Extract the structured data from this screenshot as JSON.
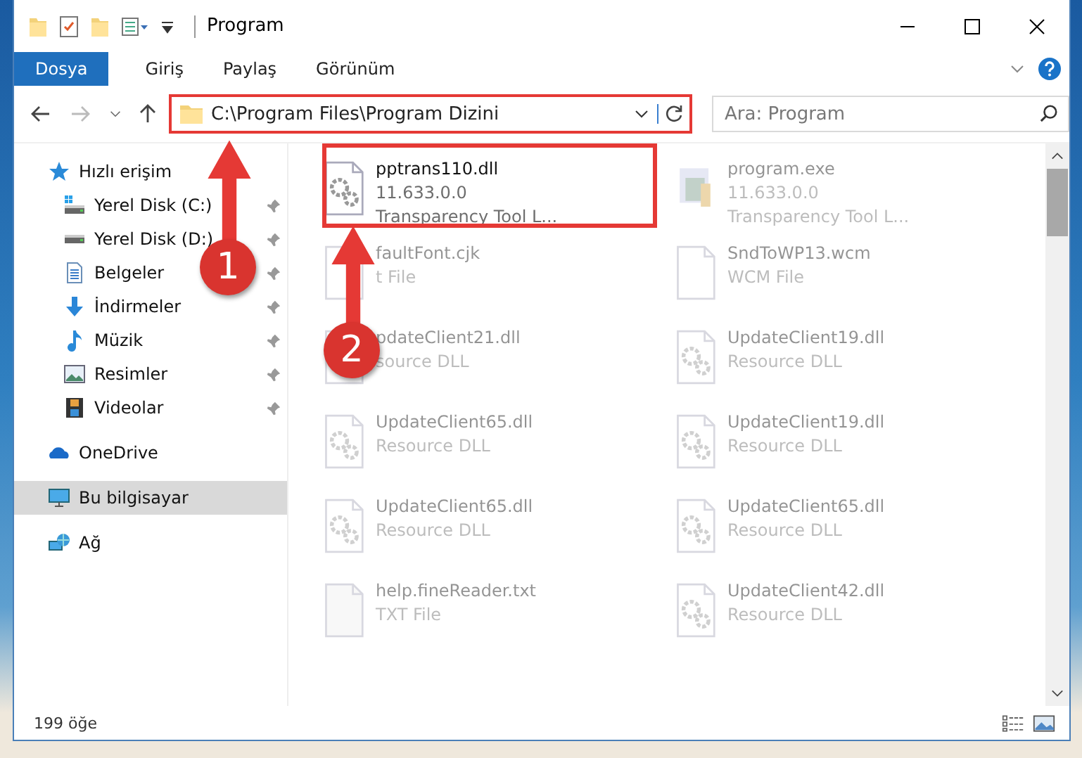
{
  "window": {
    "title": "Program"
  },
  "ribbon_tabs": [
    {
      "label": "Dosya",
      "kind": "file"
    },
    {
      "label": "Giriş",
      "kind": "tab"
    },
    {
      "label": "Paylaş",
      "kind": "tab"
    },
    {
      "label": "Görünüm",
      "kind": "tab"
    }
  ],
  "address": {
    "path": "C:\\Program Files\\Program Dizini"
  },
  "search": {
    "placeholder": "Ara: Program"
  },
  "sidebar": {
    "items": [
      {
        "label": "Hızlı erişim",
        "selected": false,
        "children": [
          {
            "label": "Yerel Disk (C:)",
            "pinned": true,
            "selected": false
          },
          {
            "label": "Yerel Disk (D:)",
            "pinned": true,
            "selected": false
          },
          {
            "label": "Belgeler",
            "pinned": true,
            "selected": false
          },
          {
            "label": "İndirmeler",
            "pinned": true,
            "selected": false
          },
          {
            "label": "Müzik",
            "pinned": true,
            "selected": false
          },
          {
            "label": "Resimler",
            "pinned": true,
            "selected": false
          },
          {
            "label": "Videolar",
            "pinned": true,
            "selected": false
          }
        ]
      },
      {
        "label": "OneDrive",
        "selected": false
      },
      {
        "label": "Bu bilgisayar",
        "selected": true
      },
      {
        "label": "Ağ",
        "selected": false
      }
    ]
  },
  "files": [
    {
      "name": "pptrans110.dll",
      "details": [
        "11.633.0.0",
        "Transparency Tool L..."
      ],
      "kind": "dll",
      "blurred": false
    },
    {
      "name": "program.exe",
      "details": [
        "11.633.0.0",
        "Transparency Tool L..."
      ],
      "kind": "exe",
      "blurred": true
    },
    {
      "name": "faultFont.cjk",
      "details": [
        "t File"
      ],
      "kind": "blank",
      "blurred": true
    },
    {
      "name": "SndToWP13.wcm",
      "details": [
        "WCM File"
      ],
      "kind": "blank",
      "blurred": true
    },
    {
      "name": "pdateClient21.dll",
      "details": [
        "source DLL"
      ],
      "kind": "dll",
      "blurred": true
    },
    {
      "name": "UpdateClient19.dll",
      "details": [
        "Resource DLL"
      ],
      "kind": "dll",
      "blurred": true
    },
    {
      "name": "UpdateClient65.dll",
      "details": [
        "Resource DLL"
      ],
      "kind": "dll",
      "blurred": true
    },
    {
      "name": "UpdateClient19.dll",
      "details": [
        "Resource DLL"
      ],
      "kind": "dll",
      "blurred": true
    },
    {
      "name": "UpdateClient65.dll",
      "details": [
        "Resource DLL"
      ],
      "kind": "dll",
      "blurred": true
    },
    {
      "name": "UpdateClient65.dll",
      "details": [
        "Resource DLL"
      ],
      "kind": "dll",
      "blurred": true
    },
    {
      "name": "help.fineReader.txt",
      "details": [
        "TXT File"
      ],
      "kind": "txt",
      "blurred": true
    },
    {
      "name": "UpdateClient42.dll",
      "details": [
        "Resource DLL"
      ],
      "kind": "dll",
      "blurred": true
    }
  ],
  "status_bar": {
    "count": "199 öğe"
  },
  "annotations": [
    {
      "label": "1"
    },
    {
      "label": "2"
    }
  ]
}
